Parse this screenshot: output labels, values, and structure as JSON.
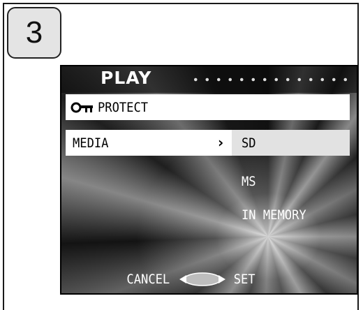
{
  "step": {
    "number": "3"
  },
  "screen": {
    "title": "PLAY",
    "menu": [
      {
        "label": "PROTECT",
        "icon": "key-icon"
      },
      {
        "label": "MEDIA",
        "icon": "chevron-right-icon",
        "arrow": "›"
      }
    ],
    "submenu": {
      "items": [
        {
          "label": "SD",
          "selected": true
        },
        {
          "label": "MS",
          "selected": false
        },
        {
          "label": "IN MEMORY",
          "selected": false
        }
      ]
    },
    "footer": {
      "cancel_label": "CANCEL",
      "set_label": "SET",
      "nav_icon": "left-right-pad-icon"
    }
  },
  "colors": {
    "highlight": "#ffffff",
    "submenu_selected": "#e2e2e2",
    "text_light": "#ffffff",
    "text_dark": "#000000"
  }
}
